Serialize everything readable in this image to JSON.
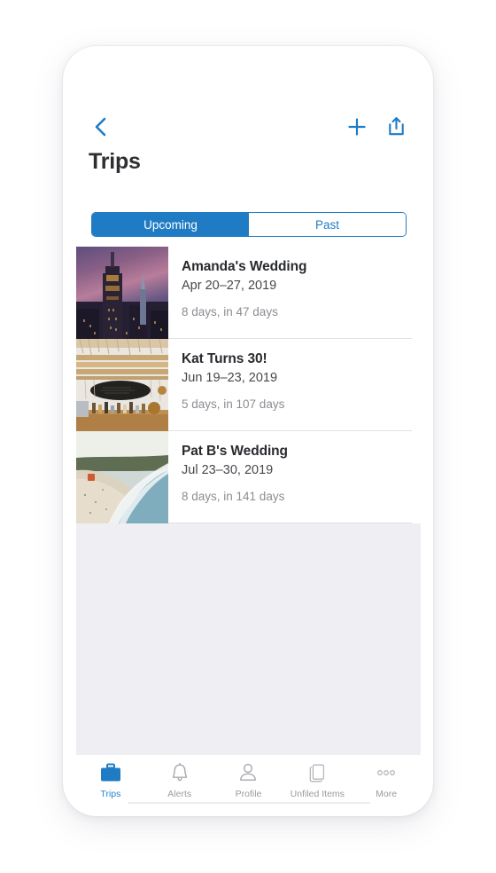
{
  "app": {
    "accent_color": "#1f7cc4",
    "tab_active_color": "#2686cf",
    "title": "Trips"
  },
  "nav": {
    "back_icon": "chevron-left-icon",
    "add_icon": "plus-icon",
    "share_icon": "share-icon"
  },
  "segmented_control": {
    "options": [
      {
        "label": "Upcoming",
        "selected": true
      },
      {
        "label": "Past",
        "selected": false
      }
    ]
  },
  "trips": [
    {
      "title": "Amanda's Wedding",
      "dates": "Apr 20–27, 2019",
      "duration": "8 days, in 47 days",
      "thumbnail": "city-skyline-night-photo"
    },
    {
      "title": "Kat Turns 30!",
      "dates": "Jun 19–23, 2019",
      "duration": "5 days, in 107 days",
      "thumbnail": "tiki-bar-interior-photo"
    },
    {
      "title": "Pat B's Wedding",
      "dates": "Jul 23–30, 2019",
      "duration": "8 days, in 141 days",
      "thumbnail": "beach-coastline-photo"
    }
  ],
  "tab_bar": {
    "items": [
      {
        "label": "Trips",
        "icon": "briefcase-icon",
        "active": true
      },
      {
        "label": "Alerts",
        "icon": "bell-icon",
        "active": false
      },
      {
        "label": "Profile",
        "icon": "person-icon",
        "active": false
      },
      {
        "label": "Unfiled Items",
        "icon": "documents-icon",
        "active": false
      },
      {
        "label": "More",
        "icon": "ellipsis-icon",
        "active": false
      }
    ]
  }
}
